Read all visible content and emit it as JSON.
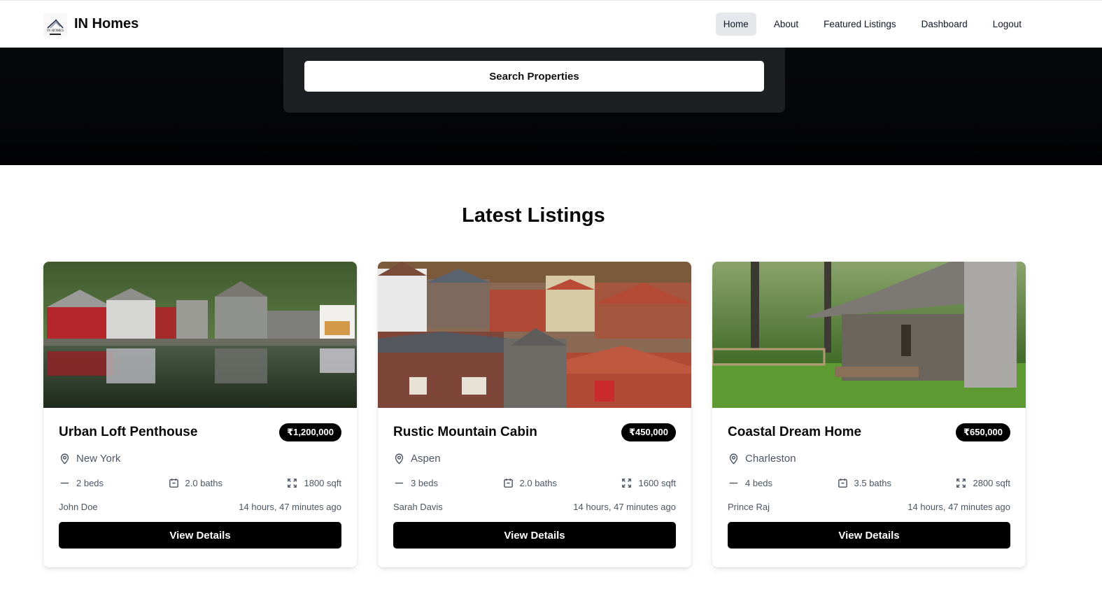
{
  "navbar": {
    "brand_name": "IN Homes",
    "logo_text": "IN HOMES",
    "links": [
      {
        "label": "Home",
        "active": true
      },
      {
        "label": "About",
        "active": false
      },
      {
        "label": "Featured Listings",
        "active": false
      },
      {
        "label": "Dashboard",
        "active": false
      },
      {
        "label": "Logout",
        "active": false
      }
    ]
  },
  "hero": {
    "search_button_label": "Search Properties"
  },
  "latest": {
    "title": "Latest Listings",
    "listings": [
      {
        "title": "Urban Loft Penthouse",
        "price": "₹1,200,000",
        "location": "New York",
        "beds": "2 beds",
        "baths": "2.0 baths",
        "area": "1800 sqft",
        "agent": "John Doe",
        "posted": "14 hours, 47 minutes ago",
        "button_label": "View Details",
        "image_alt": "Waterfront village houses reflected in a lake"
      },
      {
        "title": "Rustic Mountain Cabin",
        "price": "₹450,000",
        "location": "Aspen",
        "beds": "3 beds",
        "baths": "2.0 baths",
        "area": "1600 sqft",
        "agent": "Sarah Davis",
        "posted": "14 hours, 47 minutes ago",
        "button_label": "View Details",
        "image_alt": "Red-tiled rooftops of a town"
      },
      {
        "title": "Coastal Dream Home",
        "price": "₹650,000",
        "location": "Charleston",
        "beds": "4 beds",
        "baths": "3.5 baths",
        "area": "2800 sqft",
        "agent": "Prince Raj",
        "posted": "14 hours, 47 minutes ago",
        "button_label": "View Details",
        "image_alt": "Log cabin with stone chimney on a green lawn"
      }
    ]
  },
  "colors": {
    "primary": "#000000",
    "nav_active_bg": "#e5e7eb",
    "muted_text": "#4b5563",
    "hero_bg": "#05060a",
    "search_panel_bg": "#1e1f22"
  }
}
